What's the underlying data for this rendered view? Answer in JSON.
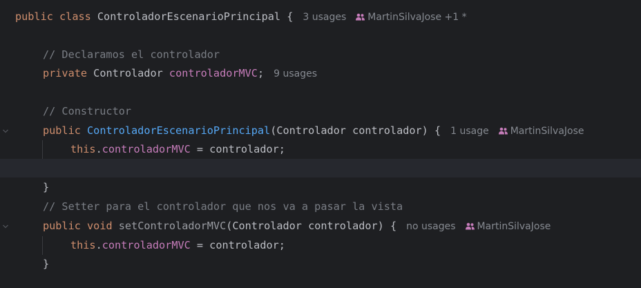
{
  "editor": {
    "background": "#1e1f22",
    "lines": {
      "l1": {
        "public": "public",
        "class": "class",
        "name": "ControladorEscenarioPrincipal",
        "brace": " {",
        "usages": "3 usages",
        "author": "MartinSilvaJose +1 *"
      },
      "l2": {
        "comment": "// Declaramos el controlador"
      },
      "l3": {
        "private": "private",
        "type": "Controlador",
        "field": "controladorMVC",
        "semi": ";",
        "usages": "9 usages"
      },
      "l4": {
        "comment": "// Constructor"
      },
      "l5": {
        "public": "public",
        "ctor": "ControladorEscenarioPrincipal",
        "params": "(Controlador controlador) {",
        "usages": "1 usage",
        "author": "MartinSilvaJose"
      },
      "l6": {
        "this": "this",
        "dot": ".",
        "field": "controladorMVC",
        "rest": " = controlador;"
      },
      "l7": {
        "brace": "}"
      },
      "l8": {
        "comment": "// Setter para el controlador que nos va a pasar la vista"
      },
      "l9": {
        "public": "public",
        "void": "void",
        "method": "setControladorMVC",
        "params": "(Controlador controlador) {",
        "usages": "no usages",
        "author": "MartinSilvaJose"
      },
      "l10": {
        "this": "this",
        "dot": ".",
        "field": "controladorMVC",
        "rest": " = controlador;"
      },
      "l11": {
        "brace": "}"
      }
    },
    "icons": {
      "author": "people-icon",
      "fold": "chevron-down-icon"
    },
    "colors": {
      "keyword": "#cf8e6d",
      "field": "#c77dbb",
      "constructor": "#56a8f5",
      "comment": "#7a7e85",
      "text": "#bcbec4",
      "hint": "#868a91",
      "author_icon": "#c77dbb"
    }
  }
}
